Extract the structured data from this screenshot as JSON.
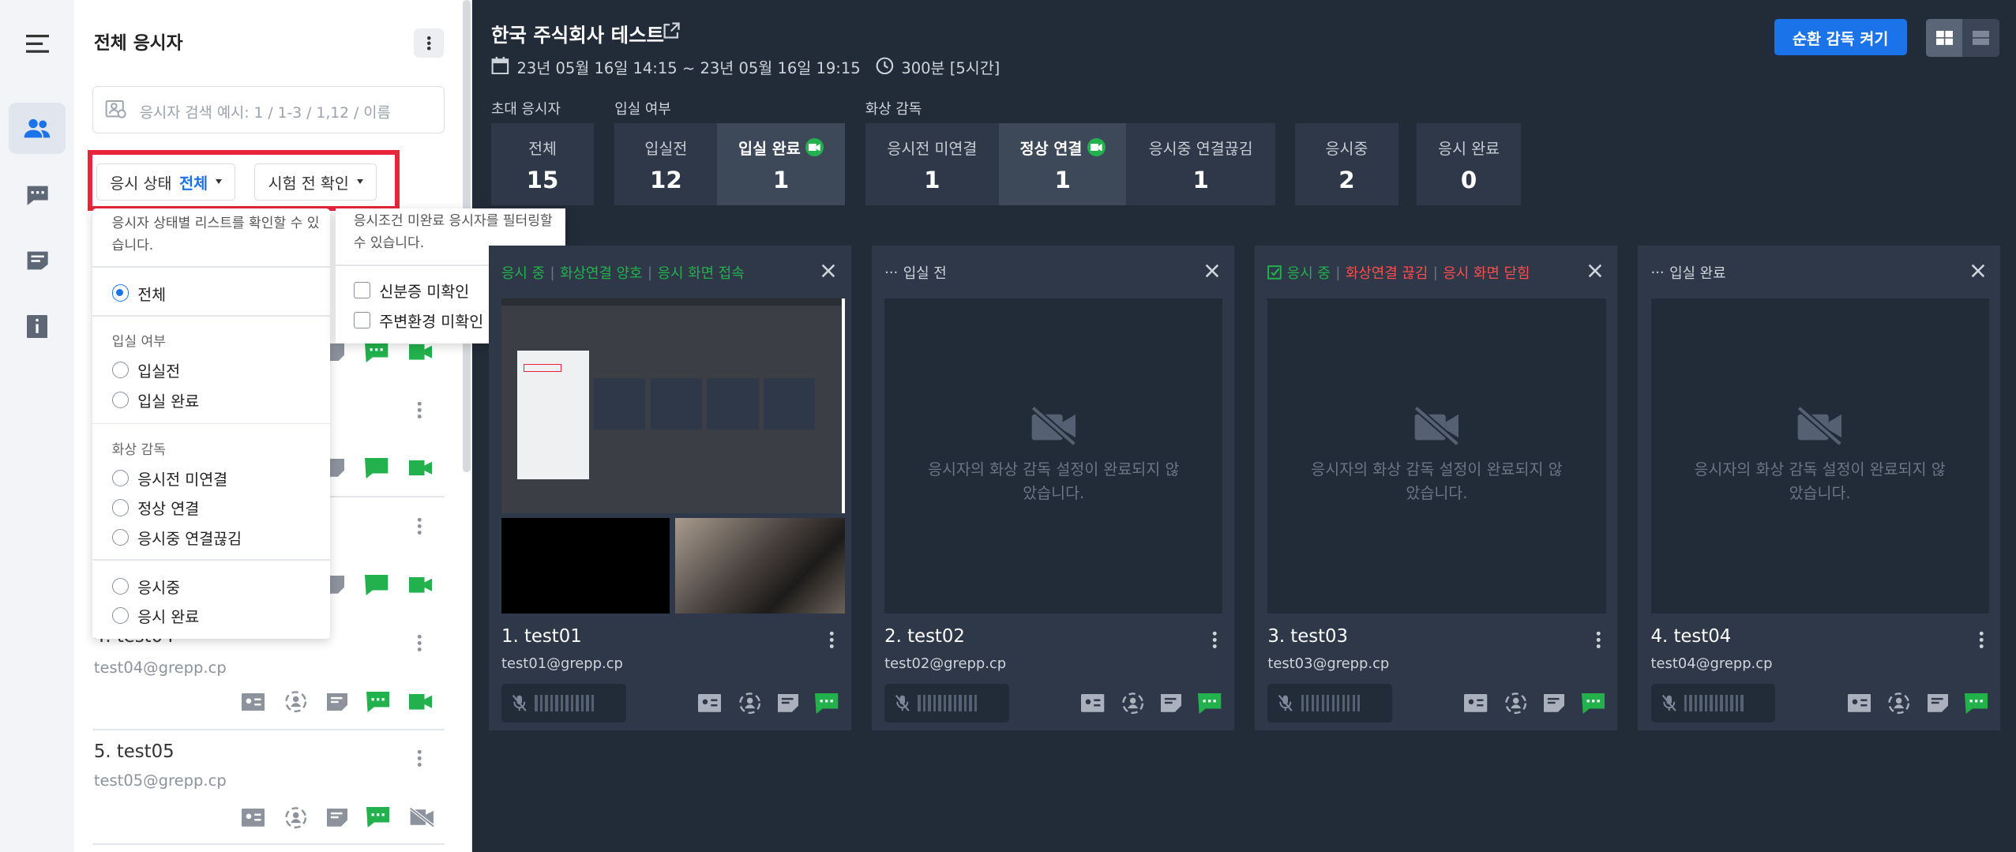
{
  "panel": {
    "title": "전체 응시자",
    "search_placeholder": "응시자 검색 예시: 1 / 1-3 / 1,12 / 이름",
    "filter_status_label": "응시 상태",
    "filter_status_value": "전체",
    "filter_precheck_label": "시험 전 확인",
    "rows": [
      {
        "name": "4. test04",
        "email": "test04@grepp.cp"
      },
      {
        "name": "5. test05",
        "email": "test05@grepp.cp"
      }
    ]
  },
  "status_dropdown": {
    "hint": "응시자 상태별 리스트를 확인할 수 있습니다.",
    "all": "전체",
    "section_entry": "입실 여부",
    "before_entry": "입실전",
    "entry_done": "입실 완료",
    "section_video": "화상 감독",
    "not_connected": "응시전 미연결",
    "connected": "정상 연결",
    "disconnected": "응시중 연결끊김",
    "in_progress": "응시중",
    "done": "응시 완료"
  },
  "precheck_dropdown": {
    "hint": "응시조건 미완료 응시자를 필터링할 수 있습니다.",
    "id_unchecked": "신분증 미확인",
    "env_unchecked": "주변환경 미확인"
  },
  "header": {
    "title": "한국 주식회사 테스트",
    "schedule": "23년 05월 16일 14:15 ~ 23년 05월 16일 19:15",
    "duration": "300분 [5시간]",
    "rotate_button": "순환 감독 켜기"
  },
  "stats": {
    "group_invited": "초대 응시자",
    "group_entry": "입실 여부",
    "group_video": "화상 감독",
    "total_label": "전체",
    "total_value": "15",
    "before_label": "입실전",
    "before_value": "12",
    "entered_label": "입실 완료",
    "entered_value": "1",
    "notconn_label": "응시전 미연결",
    "notconn_value": "1",
    "conn_label": "정상 연결",
    "conn_value": "1",
    "disconn_label": "응시중 연결끊김",
    "disconn_value": "1",
    "inprog_label": "응시중",
    "inprog_value": "2",
    "done_label": "응시 완료",
    "done_value": "0"
  },
  "cards": [
    {
      "name": "1. test01",
      "email": "test01@grepp.cp",
      "status_a": "응시 중",
      "status_b": "화상연결 양호",
      "status_c": "응시 화면 접속"
    },
    {
      "name": "2. test02",
      "email": "test02@grepp.cp",
      "status": "입실 전",
      "placeholder": "응시자의 화상 감독 설정이 완료되지 않았습니다."
    },
    {
      "name": "3. test03",
      "email": "test03@grepp.cp",
      "status_a": "응시 중",
      "status_b": "화상연결 끊김",
      "status_c": "응시 화면 닫힘",
      "placeholder": "응시자의 화상 감독 설정이 완료되지 않았습니다."
    },
    {
      "name": "4. test04",
      "email": "test04@grepp.cp",
      "status": "입실 완료",
      "placeholder": "응시자의 화상 감독 설정이 완료되지 않았습니다."
    }
  ],
  "colors": {
    "primary": "#1a73e8",
    "success": "#22b14c",
    "danger": "#ff4d4d",
    "highlight": "#e8253a",
    "background": "#222b38"
  }
}
